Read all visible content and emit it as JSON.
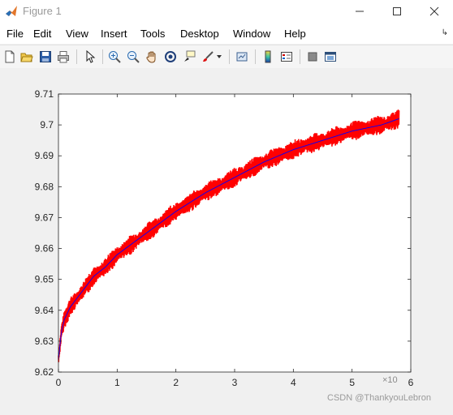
{
  "window": {
    "title": "Figure 1"
  },
  "menu": {
    "items": [
      "File",
      "Edit",
      "View",
      "Insert",
      "Tools",
      "Desktop",
      "Window",
      "Help"
    ]
  },
  "toolbar": {
    "icons": [
      "new-figure-icon",
      "open-file-icon",
      "save-icon",
      "print-icon",
      "select-arrow-icon",
      "zoom-in-icon",
      "zoom-out-icon",
      "pan-hand-icon",
      "rotate-3d-icon",
      "data-cursor-icon",
      "brush-icon",
      "brush-dropdown-icon",
      "link-plot-icon",
      "colorbar-icon",
      "legend-icon",
      "hide-plot-tools-icon",
      "show-plot-tools-icon"
    ]
  },
  "watermark": "CSDN @ThankyouLebron",
  "chart_data": {
    "type": "line",
    "xlabel": "",
    "ylabel": "",
    "x_exponent_label": "×10",
    "xlim": [
      0,
      6
    ],
    "ylim": [
      9.62,
      9.71
    ],
    "xticks": [
      "0",
      "1",
      "2",
      "3",
      "4",
      "5",
      "6"
    ],
    "yticks": [
      "9.62",
      "9.63",
      "9.64",
      "9.65",
      "9.66",
      "9.67",
      "9.68",
      "9.69",
      "9.7",
      "9.71"
    ],
    "grid": false,
    "series": [
      {
        "color": "#ff0000",
        "style": "noisy band",
        "x": [
          0,
          0.05,
          0.1,
          0.2,
          0.4,
          0.6,
          0.8,
          1,
          1.5,
          2,
          2.5,
          3,
          3.5,
          4,
          4.5,
          5,
          5.5,
          5.8
        ],
        "y": [
          9.624,
          9.633,
          9.637,
          9.641,
          9.646,
          9.651,
          9.654,
          9.658,
          9.665,
          9.672,
          9.678,
          9.683,
          9.688,
          9.692,
          9.695,
          9.698,
          9.7,
          9.702
        ]
      },
      {
        "color": "#0000ff",
        "style": "fitted line",
        "x": [
          0,
          0.05,
          0.1,
          0.2,
          0.4,
          0.6,
          0.8,
          1,
          1.5,
          2,
          2.5,
          3,
          3.5,
          4,
          4.5,
          5,
          5.5,
          5.8
        ],
        "y": [
          9.624,
          9.633,
          9.637,
          9.641,
          9.646,
          9.651,
          9.654,
          9.658,
          9.665,
          9.672,
          9.678,
          9.683,
          9.688,
          9.692,
          9.695,
          9.698,
          9.7,
          9.702
        ]
      }
    ]
  }
}
